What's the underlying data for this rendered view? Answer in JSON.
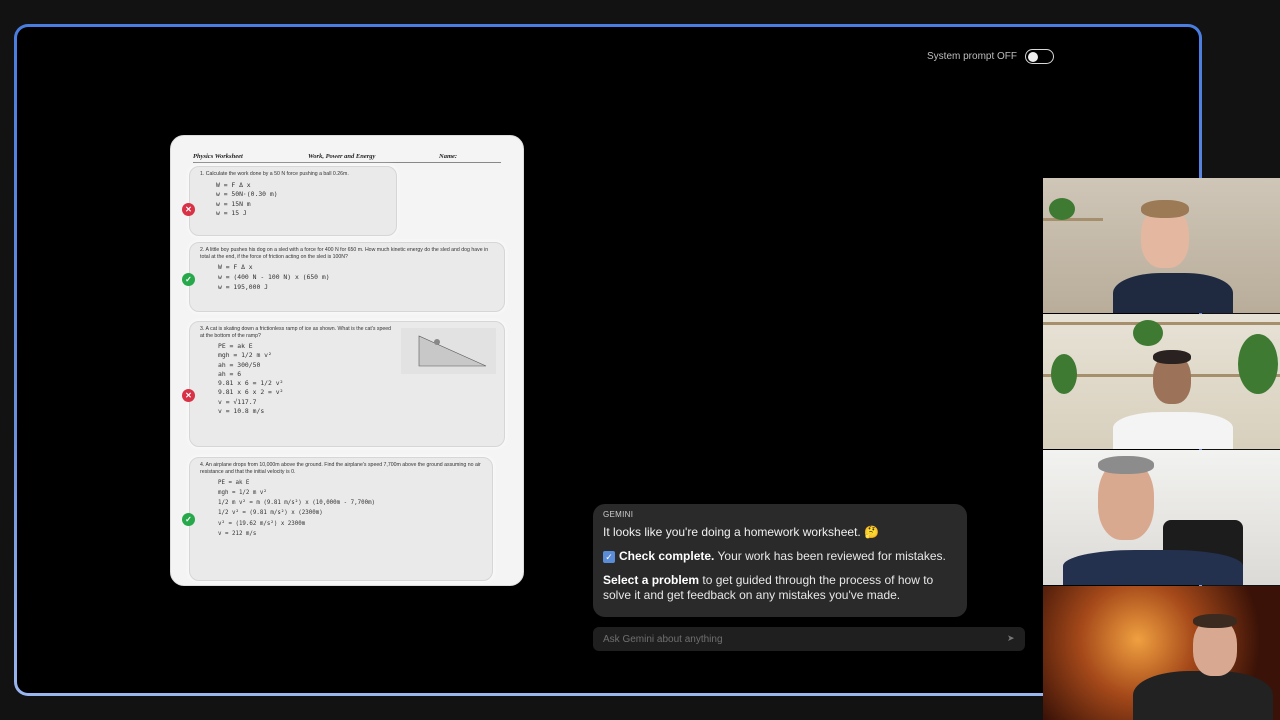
{
  "system_prompt": {
    "label": "System prompt OFF",
    "enabled": false
  },
  "worksheet": {
    "title": "Physics Worksheet",
    "topic": "Work, Power and Energy",
    "name_label": "Name:",
    "problems": [
      {
        "question": "1. Calculate the work done by a 50 N force pushing a ball 0.26m.",
        "work": "W = F Δ x\nw = 50N·(0.30 m)\nw = 15N m\nw = 15 J",
        "status": "incorrect"
      },
      {
        "question": "2. A little boy pushes his dog on a sled with a force for 400 N for 650 m. How much kinetic energy do the sled and dog have in total at the end, if the force of friction acting on the sled is 100N?",
        "work": "W = F Δ x\nw = (400 N - 100 N) x (650 m)\nw = 195,000 J",
        "status": "correct"
      },
      {
        "question": "3. A cat is skating down a frictionless ramp of ice as shown. What is the cat's speed at the bottom of the ramp?",
        "work": "PE = ak E\nmgh = 1/2 m v²\nah = 300/50\nah = 6\n9.81 x 6 = 1/2 v²\n9.81 x 6 x 2 = v²\nv = √117.7\nv = 10.8 m/s",
        "status": "incorrect"
      },
      {
        "question": "4. An airplane drops from 10,000m above the ground. Find the airplane's speed 7,700m above the ground assuming no air resistance and that the initial velocity is 0.",
        "work": "PE = ak E\nmgh = 1/2 m v²\n1/2 m v² = m (9.81 m/s²) x (10,000m - 7,700m)\n1/2 v² = (9.81 m/s²) x (2300m)\nv² = (19.62 m/s²) x 2300m\nv = 212 m/s",
        "status": "correct"
      }
    ]
  },
  "gemini": {
    "label": "GEMINI",
    "line1": "It looks like you're doing a homework worksheet. 🤔",
    "check_bold": "Check complete.",
    "check_rest": " Your work has been reviewed for mistakes.",
    "select_bold": "Select a problem",
    "select_rest": " to get guided through the process of how to solve it and get feedback on any mistakes you've made."
  },
  "ask": {
    "placeholder": "Ask Gemini about anything"
  },
  "icons": {
    "incorrect": "x-circle-icon",
    "correct": "check-circle-icon",
    "send": "send-icon",
    "checkbox": "checkbox-icon"
  },
  "colors": {
    "incorrect": "#d93145",
    "correct": "#27a84a",
    "border_accent": "#4a7de0"
  }
}
